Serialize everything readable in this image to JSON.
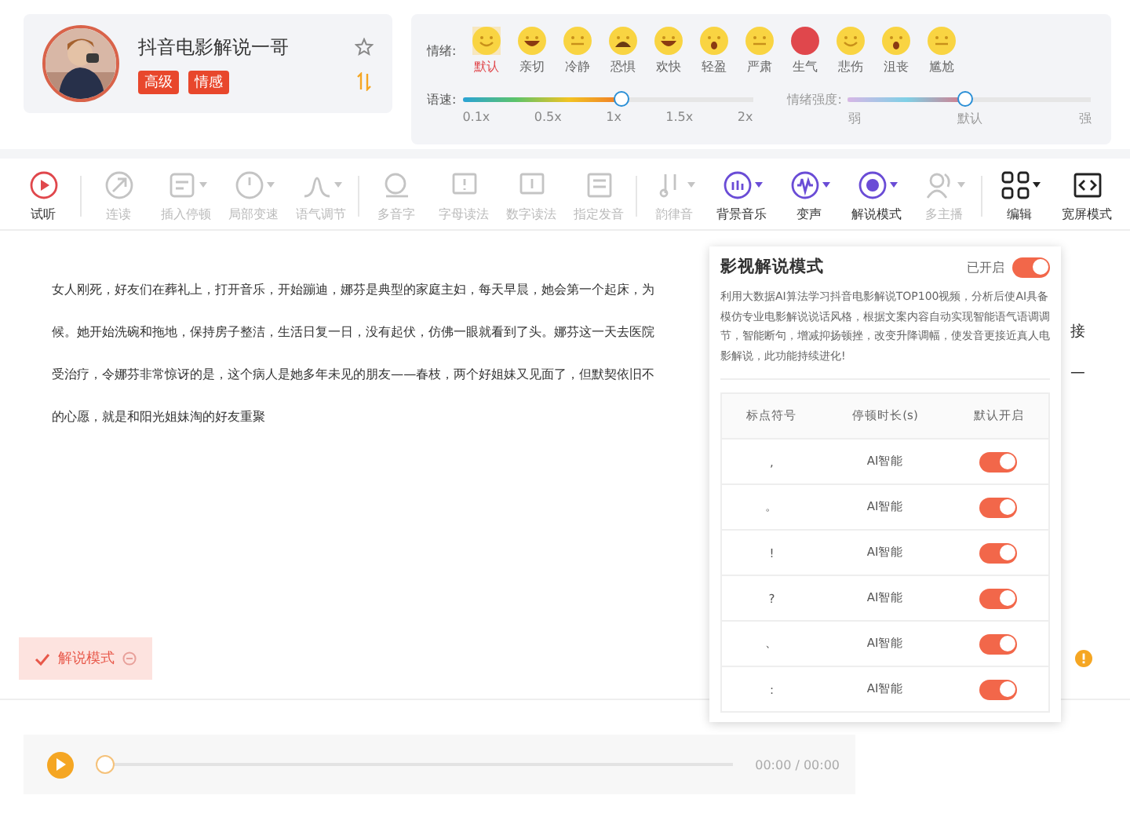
{
  "profile": {
    "name": "抖音电影解说一哥",
    "badges": [
      "高级",
      "情感"
    ],
    "favorite": false
  },
  "emotions": {
    "label": "情绪:",
    "items": [
      {
        "name": "默认",
        "kind": "face",
        "selected": true
      },
      {
        "name": "亲切",
        "kind": "grin",
        "selected": false
      },
      {
        "name": "冷静",
        "kind": "flat",
        "selected": false
      },
      {
        "name": "恐惧",
        "kind": "fear",
        "selected": false
      },
      {
        "name": "欢快",
        "kind": "grin",
        "selected": false
      },
      {
        "name": "轻盈",
        "kind": "wow",
        "selected": false
      },
      {
        "name": "严肃",
        "kind": "flat",
        "selected": false
      },
      {
        "name": "生气",
        "kind": "angry",
        "selected": false
      },
      {
        "name": "悲伤",
        "kind": "face",
        "selected": false
      },
      {
        "name": "沮丧",
        "kind": "wow",
        "selected": false
      },
      {
        "name": "尴尬",
        "kind": "flat",
        "selected": false
      }
    ]
  },
  "speed": {
    "label": "语速:",
    "level": 0.55,
    "ticks": [
      "0.1x",
      "0.5x",
      "1x",
      "1.5x",
      "2x"
    ],
    "disabled": false
  },
  "intensity": {
    "label": "情绪强度:",
    "level": 0.48,
    "ticks": [
      "弱",
      "默认",
      "强"
    ],
    "disabled": true
  },
  "toolbar": [
    {
      "label": "试听",
      "kind": "play",
      "disabled": false,
      "dropdown": false,
      "separator": true
    },
    {
      "label": "连读",
      "kind": "tool",
      "disabled": true,
      "dropdown": false,
      "separator": false
    },
    {
      "label": "插入停顿",
      "kind": "tool",
      "disabled": true,
      "dropdown": true,
      "separator": false
    },
    {
      "label": "局部变速",
      "kind": "tool",
      "disabled": true,
      "dropdown": true,
      "separator": false
    },
    {
      "label": "语气调节",
      "kind": "tool",
      "disabled": true,
      "dropdown": true,
      "separator": true
    },
    {
      "label": "多音字",
      "kind": "tool",
      "disabled": true,
      "dropdown": false,
      "separator": false
    },
    {
      "label": "字母读法",
      "kind": "tool",
      "disabled": true,
      "dropdown": false,
      "separator": false
    },
    {
      "label": "数字读法",
      "kind": "tool",
      "disabled": true,
      "dropdown": false,
      "separator": false
    },
    {
      "label": "指定发音",
      "kind": "tool",
      "disabled": true,
      "dropdown": false,
      "separator": true
    },
    {
      "label": "韵律音",
      "kind": "tool",
      "disabled": true,
      "dropdown": true,
      "separator": false
    },
    {
      "label": "背景音乐",
      "kind": "effect",
      "disabled": false,
      "dropdown": true,
      "separator": false
    },
    {
      "label": "变声",
      "kind": "effect",
      "disabled": false,
      "dropdown": true,
      "separator": false
    },
    {
      "label": "解说模式",
      "kind": "effect",
      "disabled": false,
      "dropdown": true,
      "separator": false
    },
    {
      "label": "多主播",
      "kind": "tool",
      "disabled": true,
      "dropdown": true,
      "separator": true
    },
    {
      "label": "编辑",
      "kind": "view",
      "disabled": false,
      "dropdown": true,
      "separator": false
    },
    {
      "label": "宽屏模式",
      "kind": "view",
      "disabled": false,
      "dropdown": false,
      "separator": false
    }
  ],
  "text_lines": [
    {
      "text": "女人刚死，好友们在葬礼上，打开音乐，开始蹦迪，娜芬是典型的家庭主妇，每天早晨，她会第一个起床，为"
    },
    {
      "text": "候。她开始洗碗和拖地，保持房子整洁，生活日复一日，没有起伏，仿佛一眼就看到了头。娜芬这一天去医院",
      "tail": "接"
    },
    {
      "text": "受治疗，令娜芬非常惊讶的是，这个病人是她多年未见的朋友——春枝，两个好姐妹又见面了，但默契依旧不",
      "tail": "一"
    },
    {
      "text": "的心愿，就是和阳光姐妹淘的好友重聚"
    }
  ],
  "mode_tag": {
    "label": "解说模式"
  },
  "popup": {
    "title": "影视解说模式",
    "status": "已开启",
    "on": true,
    "description": "利用大数据AI算法学习抖音电影解说TOP100视频，分析后使AI具备模仿专业电影解说说话风格，根据文案内容自动实现智能语气语调调节，智能断句，增减抑扬顿挫，改变升降调幅，使发音更接近真人电影解说，此功能持续进化!",
    "columns": [
      "标点符号",
      "停顿时长(s)",
      "默认开启"
    ],
    "rows": [
      {
        "symbol": ",",
        "duration": "AI智能",
        "on": true
      },
      {
        "symbol": "。",
        "duration": "AI智能",
        "on": true
      },
      {
        "symbol": "!",
        "duration": "AI智能",
        "on": true
      },
      {
        "symbol": "?",
        "duration": "AI智能",
        "on": true
      },
      {
        "symbol": "、",
        "duration": "AI智能",
        "on": true
      },
      {
        "symbol": ":",
        "duration": "AI智能",
        "on": true
      }
    ]
  },
  "player": {
    "time": "00:00 / 00:00",
    "level": 0
  }
}
